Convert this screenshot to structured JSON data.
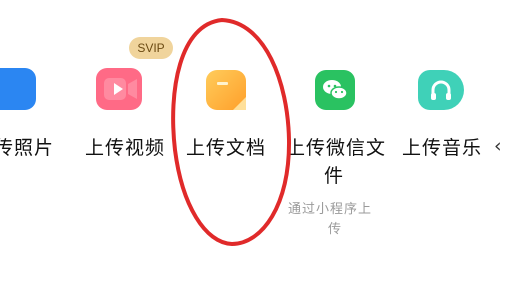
{
  "items": [
    {
      "label": "传照片",
      "icon": "photo-icon",
      "color": "#1e7be6"
    },
    {
      "label": "上传视频",
      "icon": "video-icon",
      "color": "#ff5a7a",
      "badge": "SVIP"
    },
    {
      "label": "上传文档",
      "icon": "document-icon",
      "color": "#ffb33a"
    },
    {
      "label": "上传微信文",
      "label_line2": "件",
      "icon": "wechat-icon",
      "color": "#27c25d",
      "sublabel_line1": "通过小程序上",
      "sublabel_line2": "传"
    },
    {
      "label": "上传音乐",
      "icon": "music-icon",
      "color": "#39cdb4"
    }
  ],
  "annotation": {
    "shape": "hand-drawn-ellipse",
    "color": "#e02a2a"
  },
  "edge_fragment": "‹"
}
